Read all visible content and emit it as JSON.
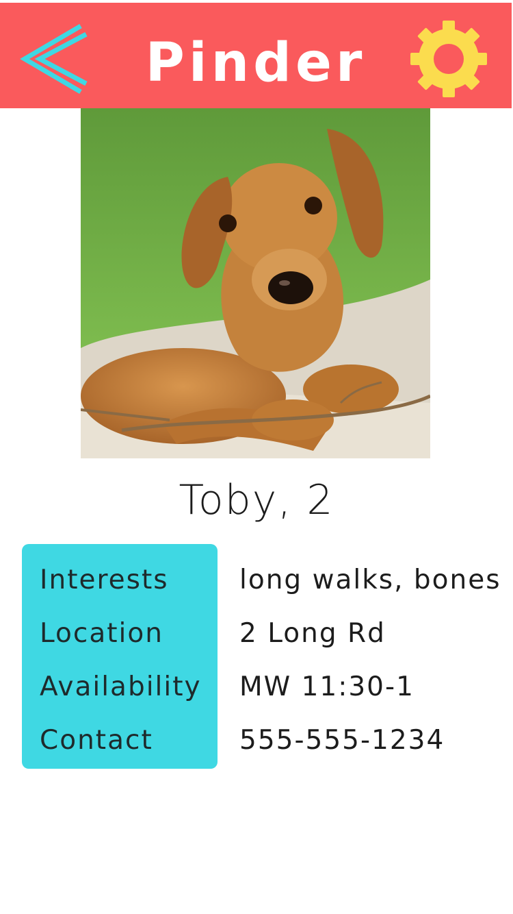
{
  "header": {
    "title": "Pinder",
    "back_icon": "chevron-left-icon",
    "settings_icon": "gear-icon",
    "background_color": "#fa5a5c",
    "back_icon_color": "#3fd8e3",
    "settings_icon_color": "#fbdc4e"
  },
  "profile": {
    "photo_subject": "dachshund puppy",
    "name_age": "Toby, 2"
  },
  "details": {
    "label_box_color": "#3fd8e3",
    "rows": [
      {
        "label": "Interests",
        "value": "long walks, bones"
      },
      {
        "label": "Location",
        "value": "2 Long Rd"
      },
      {
        "label": "Availability",
        "value": "MW 11:30-1"
      },
      {
        "label": "Contact",
        "value": "555-555-1234"
      }
    ]
  }
}
